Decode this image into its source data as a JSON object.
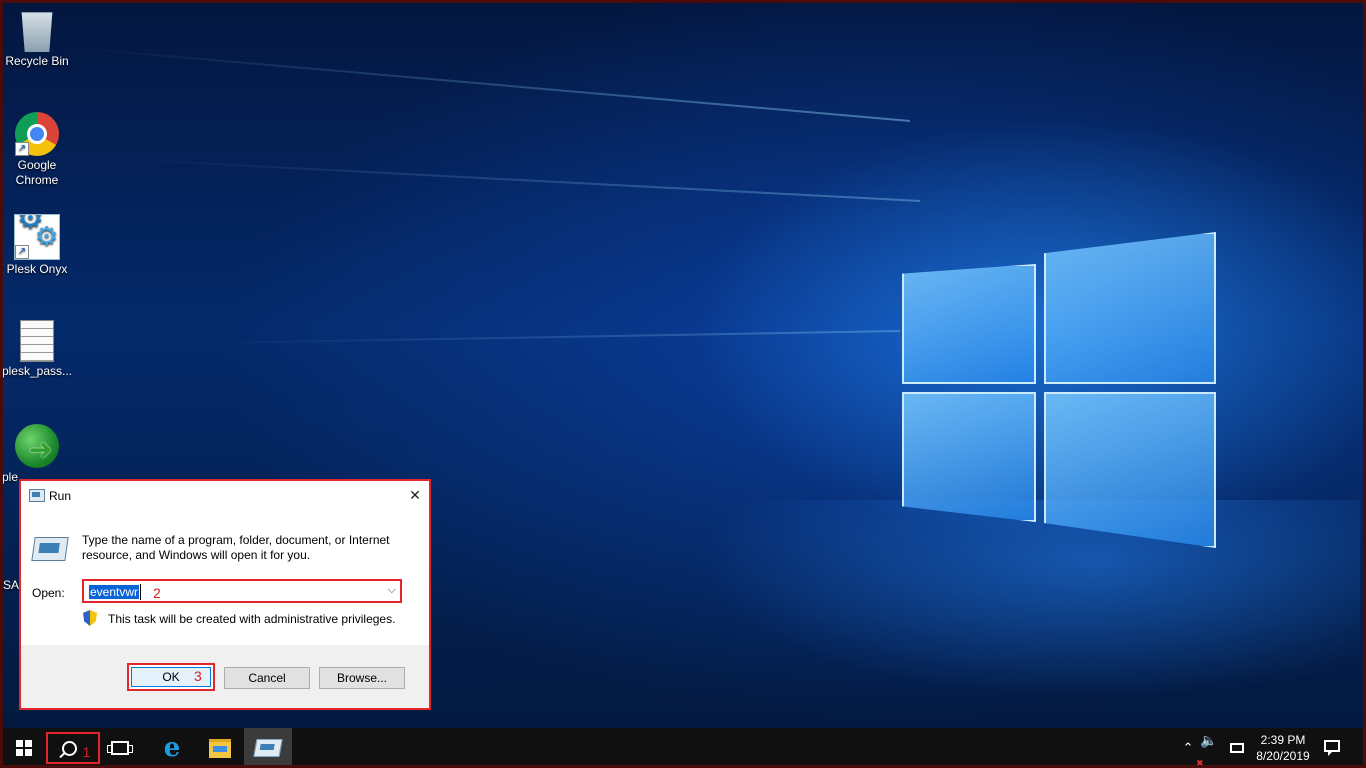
{
  "desktop": {
    "icons": [
      {
        "label": "Recycle Bin",
        "icon": "recycle-bin-icon"
      },
      {
        "label": "Google\nChrome",
        "icon": "chrome-icon"
      },
      {
        "label": "Plesk Onyx",
        "icon": "plesk-icon"
      },
      {
        "label": "plesk_pass...",
        "icon": "text-file-icon"
      },
      {
        "label": "ple",
        "icon": "globe-download-icon"
      }
    ],
    "partial_label": "SA"
  },
  "run_dialog": {
    "title": "Run",
    "description": "Type the name of a program, folder, document, or Internet resource, and Windows will open it for you.",
    "open_label": "Open:",
    "open_value": "eventvwr",
    "privilege_note": "This task will be created with administrative privileges.",
    "buttons": {
      "ok": "OK",
      "cancel": "Cancel",
      "browse": "Browse..."
    }
  },
  "annotations": {
    "step1": "1",
    "step2": "2",
    "step3": "3"
  },
  "taskbar": {
    "pinned": [
      "start",
      "search",
      "task-view",
      "internet-explorer",
      "file-explorer",
      "run"
    ],
    "clock_time": "2:39 PM",
    "clock_date": "8/20/2019"
  },
  "colors": {
    "annotation_red": "#e3262c",
    "taskbar": "#101010",
    "accent": "#0a64d6"
  }
}
